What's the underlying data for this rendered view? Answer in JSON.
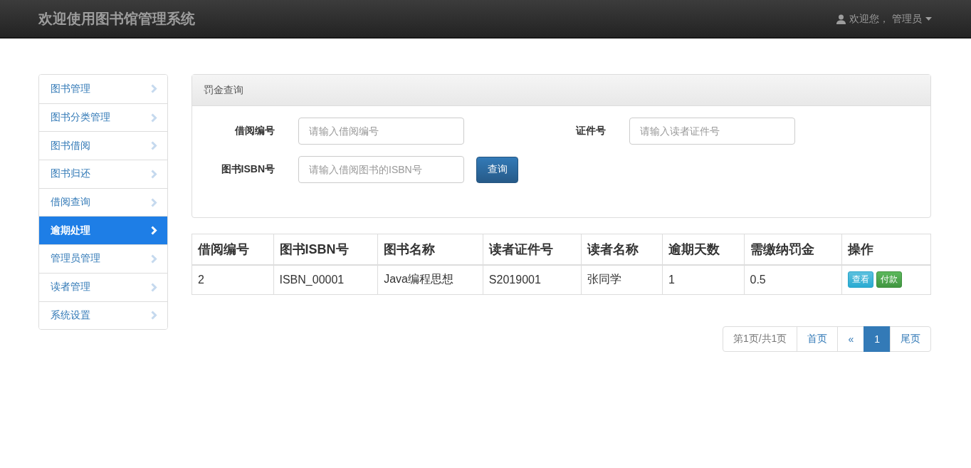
{
  "navbar": {
    "brand": "欢迎使用图书馆管理系统",
    "user": "欢迎您， 管理员"
  },
  "sidebar": {
    "items": [
      {
        "label": "图书管理",
        "selected": false
      },
      {
        "label": "图书分类管理",
        "selected": false
      },
      {
        "label": "图书借阅",
        "selected": false
      },
      {
        "label": "图书归还",
        "selected": false
      },
      {
        "label": "借阅查询",
        "selected": false
      },
      {
        "label": "逾期处理",
        "selected": true
      },
      {
        "label": "管理员管理",
        "selected": false
      },
      {
        "label": "读者管理",
        "selected": false
      },
      {
        "label": "系统设置",
        "selected": false
      }
    ]
  },
  "panel": {
    "title": "罚金查询",
    "fields": [
      {
        "label": "借阅编号",
        "placeholder": "请输入借阅编号"
      },
      {
        "label": "证件号",
        "placeholder": "请输入读者证件号"
      },
      {
        "label": "图书ISBN号",
        "placeholder": "请输入借阅图书的ISBN号"
      }
    ],
    "button": "查询"
  },
  "table": {
    "columns": [
      "借阅编号",
      "图书ISBN号",
      "图书名称",
      "读者证件号",
      "读者名称",
      "逾期天数",
      "需缴纳罚金",
      "操作"
    ],
    "rows": [
      {
        "cells": [
          "2",
          "ISBN_00001",
          "Java编程思想",
          "S2019001",
          "张同学",
          "1",
          "0.5"
        ],
        "actions": [
          {
            "label": "查看",
            "kind": "info"
          },
          {
            "label": "付款",
            "kind": "success"
          }
        ]
      }
    ]
  },
  "pagination": [
    {
      "label": "第1页/共1页",
      "kind": "info",
      "selected": false
    },
    {
      "label": "首页",
      "kind": "link",
      "selected": false
    },
    {
      "label": "«",
      "kind": "link",
      "selected": false
    },
    {
      "label": "1",
      "kind": "link",
      "selected": true
    },
    {
      "label": "尾页",
      "kind": "link",
      "selected": false
    }
  ]
}
